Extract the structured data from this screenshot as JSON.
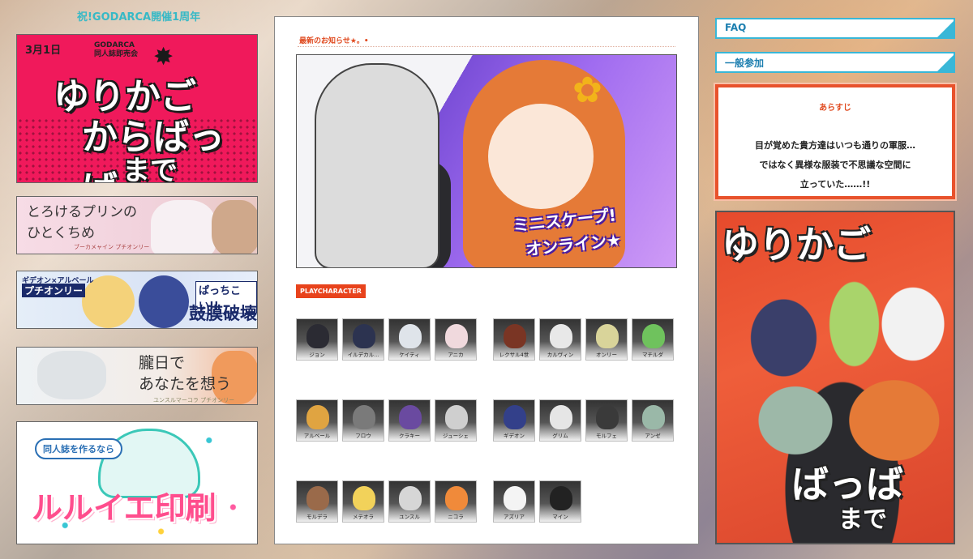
{
  "header": {
    "subtitle": "祝!GODARCA開催1周年"
  },
  "left_banners": {
    "b1": {
      "date": "3月1日",
      "org_line1": "GODARCA",
      "org_line2": "同人誌即売会",
      "title1": "ゆりかご",
      "title2": "からばっば",
      "title3": "まで"
    },
    "b2": {
      "title": "とろけるプリンの\nひとくちめ",
      "sub": "ブーカメャイン プチオンリー"
    },
    "b3": {
      "line1": "ギデオン×アルベール",
      "line2": "プチオンリー",
      "pop1": "ぱっちこい!!",
      "pop2": "鼓膜破壊"
    },
    "b4": {
      "title": "朧日で\nあなたを想う",
      "sub": "ユンスルマーコラ プチオンリー"
    },
    "b5": {
      "bubble": "同人誌を作るなら",
      "title": "ルルイエ印刷"
    }
  },
  "center": {
    "news_label": "最新のお知らせ★。•",
    "hero": {
      "logo_line1": "ミニスケープ!",
      "logo_line2": "オンライン★"
    },
    "play_label": "PLAYCHARACTER",
    "characters": [
      {
        "name": "ジョン",
        "color": "#2b2b33"
      },
      {
        "name": "イルデカル...",
        "color": "#2c3350"
      },
      {
        "name": "ケイティ",
        "color": "#dfe4ea"
      },
      {
        "name": "アニカ",
        "color": "#f0d9dd"
      },
      {
        "name": "レクサル4世",
        "color": "#7a3524"
      },
      {
        "name": "カルヴィン",
        "color": "#e8e8e8"
      },
      {
        "name": "オンリー",
        "color": "#d9d49a"
      },
      {
        "name": "マチルダ",
        "color": "#6fc25d"
      },
      {
        "name": "アルベール",
        "color": "#e0a441"
      },
      {
        "name": "フロウ",
        "color": "#7a7a7a"
      },
      {
        "name": "クラキー",
        "color": "#6a4aa0"
      },
      {
        "name": "ジューシェ",
        "color": "#cfcfcf"
      },
      {
        "name": "ギデオン",
        "color": "#33408a"
      },
      {
        "name": "グリム",
        "color": "#e6e6e6"
      },
      {
        "name": "モルフェ",
        "color": "#3a3a3a"
      },
      {
        "name": "アンゼ",
        "color": "#9ab8a8"
      },
      {
        "name": "モルデラ",
        "color": "#9a6a4a"
      },
      {
        "name": "メテオラ",
        "color": "#f2d25a"
      },
      {
        "name": "ユンスル",
        "color": "#d6d6d6"
      },
      {
        "name": "ニコラ",
        "color": "#f08a3a"
      },
      {
        "name": "アズリア",
        "color": "#f4f4f4"
      },
      {
        "name": "マイン",
        "color": "#222222"
      }
    ]
  },
  "right": {
    "faq_label": "FAQ",
    "general_label": "一般参加",
    "synopsis": {
      "heading": "あらすじ",
      "body": "目が覚めた貴方達はいつも通りの軍服…\nではなく異様な服装で不思議な空間に\n立っていた……!!"
    },
    "cover": {
      "title": "ゆりかご",
      "sub1": "ばっば",
      "sub2": "まで"
    }
  },
  "accent_colors": {
    "teal": "#39b7d7",
    "orange": "#e8522c",
    "pink": "#f0195b"
  }
}
